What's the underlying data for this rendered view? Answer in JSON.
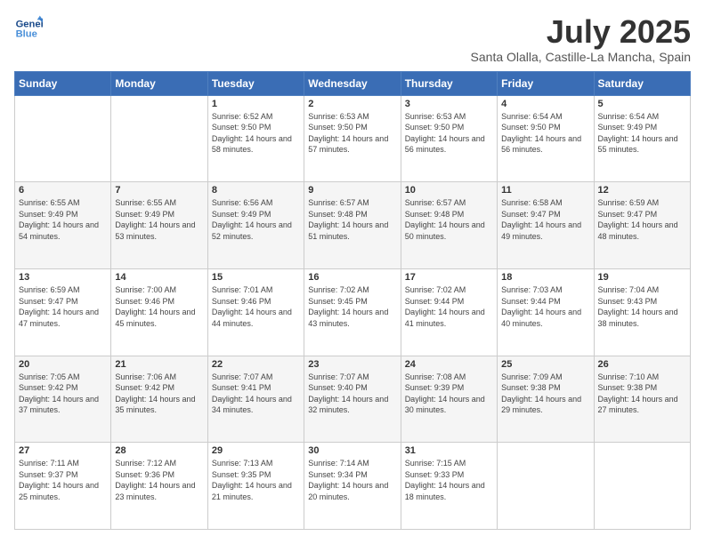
{
  "logo": {
    "line1": "General",
    "line2": "Blue"
  },
  "header": {
    "month": "July 2025",
    "location": "Santa Olalla, Castille-La Mancha, Spain"
  },
  "weekdays": [
    "Sunday",
    "Monday",
    "Tuesday",
    "Wednesday",
    "Thursday",
    "Friday",
    "Saturday"
  ],
  "weeks": [
    [
      {
        "day": "",
        "info": ""
      },
      {
        "day": "",
        "info": ""
      },
      {
        "day": "1",
        "info": "Sunrise: 6:52 AM\nSunset: 9:50 PM\nDaylight: 14 hours and 58 minutes."
      },
      {
        "day": "2",
        "info": "Sunrise: 6:53 AM\nSunset: 9:50 PM\nDaylight: 14 hours and 57 minutes."
      },
      {
        "day": "3",
        "info": "Sunrise: 6:53 AM\nSunset: 9:50 PM\nDaylight: 14 hours and 56 minutes."
      },
      {
        "day": "4",
        "info": "Sunrise: 6:54 AM\nSunset: 9:50 PM\nDaylight: 14 hours and 56 minutes."
      },
      {
        "day": "5",
        "info": "Sunrise: 6:54 AM\nSunset: 9:49 PM\nDaylight: 14 hours and 55 minutes."
      }
    ],
    [
      {
        "day": "6",
        "info": "Sunrise: 6:55 AM\nSunset: 9:49 PM\nDaylight: 14 hours and 54 minutes."
      },
      {
        "day": "7",
        "info": "Sunrise: 6:55 AM\nSunset: 9:49 PM\nDaylight: 14 hours and 53 minutes."
      },
      {
        "day": "8",
        "info": "Sunrise: 6:56 AM\nSunset: 9:49 PM\nDaylight: 14 hours and 52 minutes."
      },
      {
        "day": "9",
        "info": "Sunrise: 6:57 AM\nSunset: 9:48 PM\nDaylight: 14 hours and 51 minutes."
      },
      {
        "day": "10",
        "info": "Sunrise: 6:57 AM\nSunset: 9:48 PM\nDaylight: 14 hours and 50 minutes."
      },
      {
        "day": "11",
        "info": "Sunrise: 6:58 AM\nSunset: 9:47 PM\nDaylight: 14 hours and 49 minutes."
      },
      {
        "day": "12",
        "info": "Sunrise: 6:59 AM\nSunset: 9:47 PM\nDaylight: 14 hours and 48 minutes."
      }
    ],
    [
      {
        "day": "13",
        "info": "Sunrise: 6:59 AM\nSunset: 9:47 PM\nDaylight: 14 hours and 47 minutes."
      },
      {
        "day": "14",
        "info": "Sunrise: 7:00 AM\nSunset: 9:46 PM\nDaylight: 14 hours and 45 minutes."
      },
      {
        "day": "15",
        "info": "Sunrise: 7:01 AM\nSunset: 9:46 PM\nDaylight: 14 hours and 44 minutes."
      },
      {
        "day": "16",
        "info": "Sunrise: 7:02 AM\nSunset: 9:45 PM\nDaylight: 14 hours and 43 minutes."
      },
      {
        "day": "17",
        "info": "Sunrise: 7:02 AM\nSunset: 9:44 PM\nDaylight: 14 hours and 41 minutes."
      },
      {
        "day": "18",
        "info": "Sunrise: 7:03 AM\nSunset: 9:44 PM\nDaylight: 14 hours and 40 minutes."
      },
      {
        "day": "19",
        "info": "Sunrise: 7:04 AM\nSunset: 9:43 PM\nDaylight: 14 hours and 38 minutes."
      }
    ],
    [
      {
        "day": "20",
        "info": "Sunrise: 7:05 AM\nSunset: 9:42 PM\nDaylight: 14 hours and 37 minutes."
      },
      {
        "day": "21",
        "info": "Sunrise: 7:06 AM\nSunset: 9:42 PM\nDaylight: 14 hours and 35 minutes."
      },
      {
        "day": "22",
        "info": "Sunrise: 7:07 AM\nSunset: 9:41 PM\nDaylight: 14 hours and 34 minutes."
      },
      {
        "day": "23",
        "info": "Sunrise: 7:07 AM\nSunset: 9:40 PM\nDaylight: 14 hours and 32 minutes."
      },
      {
        "day": "24",
        "info": "Sunrise: 7:08 AM\nSunset: 9:39 PM\nDaylight: 14 hours and 30 minutes."
      },
      {
        "day": "25",
        "info": "Sunrise: 7:09 AM\nSunset: 9:38 PM\nDaylight: 14 hours and 29 minutes."
      },
      {
        "day": "26",
        "info": "Sunrise: 7:10 AM\nSunset: 9:38 PM\nDaylight: 14 hours and 27 minutes."
      }
    ],
    [
      {
        "day": "27",
        "info": "Sunrise: 7:11 AM\nSunset: 9:37 PM\nDaylight: 14 hours and 25 minutes."
      },
      {
        "day": "28",
        "info": "Sunrise: 7:12 AM\nSunset: 9:36 PM\nDaylight: 14 hours and 23 minutes."
      },
      {
        "day": "29",
        "info": "Sunrise: 7:13 AM\nSunset: 9:35 PM\nDaylight: 14 hours and 21 minutes."
      },
      {
        "day": "30",
        "info": "Sunrise: 7:14 AM\nSunset: 9:34 PM\nDaylight: 14 hours and 20 minutes."
      },
      {
        "day": "31",
        "info": "Sunrise: 7:15 AM\nSunset: 9:33 PM\nDaylight: 14 hours and 18 minutes."
      },
      {
        "day": "",
        "info": ""
      },
      {
        "day": "",
        "info": ""
      }
    ]
  ]
}
